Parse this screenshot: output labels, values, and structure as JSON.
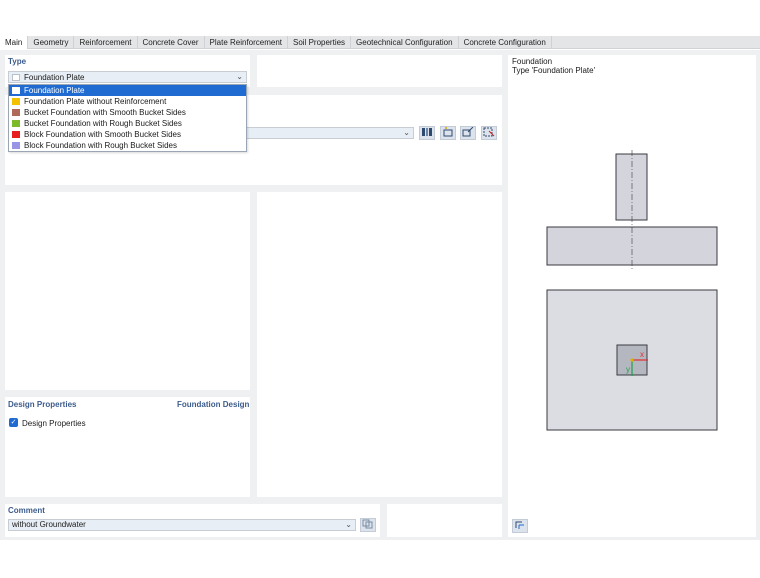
{
  "tabs": [
    {
      "label": "Main",
      "active": true
    },
    {
      "label": "Geometry"
    },
    {
      "label": "Reinforcement"
    },
    {
      "label": "Concrete Cover"
    },
    {
      "label": "Plate Reinforcement"
    },
    {
      "label": "Soil Properties"
    },
    {
      "label": "Geotechnical Configuration"
    },
    {
      "label": "Concrete Configuration"
    }
  ],
  "type_section": {
    "title": "Type",
    "selected": "Foundation Plate",
    "options": [
      {
        "label": "Foundation Plate",
        "color": "#ffffff",
        "selected": true
      },
      {
        "label": "Foundation Plate without Reinforcement",
        "color": "#f2c200"
      },
      {
        "label": "Bucket Foundation with Smooth Bucket Sides",
        "color": "#b06a5a"
      },
      {
        "label": "Bucket Foundation with Rough Bucket Sides",
        "color": "#7dba2a"
      },
      {
        "label": "Block Foundation with Smooth Bucket Sides",
        "color": "#e81e1e"
      },
      {
        "label": "Block Foundation with Rough Bucket Sides",
        "color": "#9a94e6"
      }
    ]
  },
  "toolbar_icons": [
    "library-icon",
    "new-icon",
    "edit-icon",
    "select-icon"
  ],
  "design_properties": {
    "title": "Design Properties",
    "right_title": "Foundation Design",
    "checkbox_label": "Design Properties",
    "checked": true
  },
  "comment": {
    "title": "Comment",
    "value": "without Groundwater"
  },
  "preview": {
    "title_line1": "Foundation",
    "title_line2": "Type 'Foundation Plate'",
    "axis_x": "x",
    "axis_y": "y"
  }
}
